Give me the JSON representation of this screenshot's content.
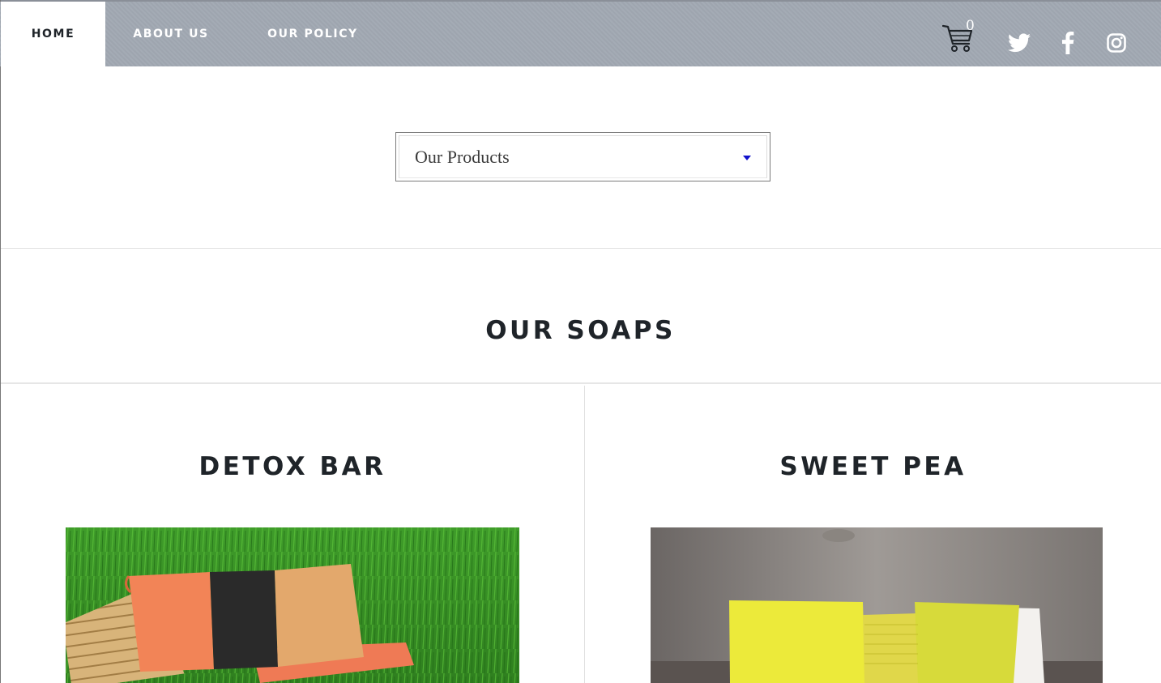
{
  "nav": {
    "home": "HOME",
    "about": "ABOUT US",
    "policy": "OUR POLICY",
    "active": "home",
    "background": "#a1a8b2"
  },
  "cart": {
    "count": "0",
    "icon": "cart-icon"
  },
  "social": [
    {
      "name": "twitter",
      "icon": "twitter-icon"
    },
    {
      "name": "facebook",
      "icon": "facebook-icon"
    },
    {
      "name": "instagram",
      "icon": "instagram-icon"
    }
  ],
  "product_select": {
    "value": "Our Products",
    "caret_color": "#1111cc"
  },
  "section": {
    "title": "OUR SOAPS"
  },
  "products": [
    {
      "title": "DETOX BAR",
      "image": "detox-bar-photo"
    },
    {
      "title": "SWEET PEA",
      "image": "sweet-pea-photo"
    }
  ],
  "colors": {
    "text": "#1f2429",
    "nav_text": "#ffffff"
  }
}
